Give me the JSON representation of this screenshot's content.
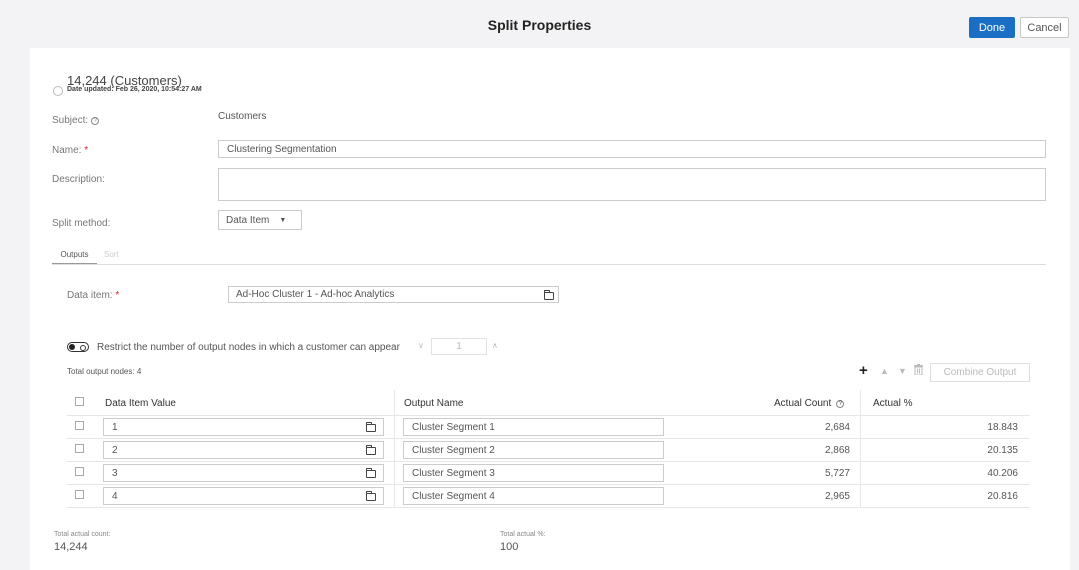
{
  "header": {
    "title": "Split Properties",
    "done_label": "Done",
    "cancel_label": "Cancel"
  },
  "summary": {
    "count_text": "14,244 (Customers)",
    "date_text": "Date updated: Feb 26, 2020, 10:54:27 AM"
  },
  "form": {
    "subject_label": "Subject:",
    "subject_value": "Customers",
    "name_label": "Name:",
    "name_value": "Clustering Segmentation",
    "description_label": "Description:",
    "description_value": "",
    "split_method_label": "Split method:",
    "split_method_value": "Data Item"
  },
  "tabs": [
    {
      "label": "Outputs",
      "active": true
    },
    {
      "label": "Sort",
      "active": false
    }
  ],
  "data_item": {
    "label": "Data item:",
    "value": "Ad-Hoc Cluster 1 - Ad-hoc Analytics"
  },
  "restrict": {
    "label": "Restrict the number of output nodes in which a customer can appear",
    "value": "1"
  },
  "total_output_nodes": "Total output nodes: 4",
  "toolbar": {
    "combine_label": "Combine Output"
  },
  "table": {
    "columns": [
      "Data Item Value",
      "Output Name",
      "Actual Count",
      "Actual %"
    ],
    "rows": [
      {
        "value": "1",
        "output_name": "Cluster Segment 1",
        "count": "2,684",
        "percent": "18.843"
      },
      {
        "value": "2",
        "output_name": "Cluster Segment 2",
        "count": "2,868",
        "percent": "20.135"
      },
      {
        "value": "3",
        "output_name": "Cluster Segment 3",
        "count": "5,727",
        "percent": "40.206"
      },
      {
        "value": "4",
        "output_name": "Cluster Segment 4",
        "count": "2,965",
        "percent": "20.816"
      }
    ]
  },
  "totals": {
    "count_label": "Total actual count:",
    "count_value": "14,244",
    "percent_label": "Total actual %:",
    "percent_value": "100"
  },
  "colors": {
    "primary": "#1a6fc4",
    "required": "#d22222"
  }
}
